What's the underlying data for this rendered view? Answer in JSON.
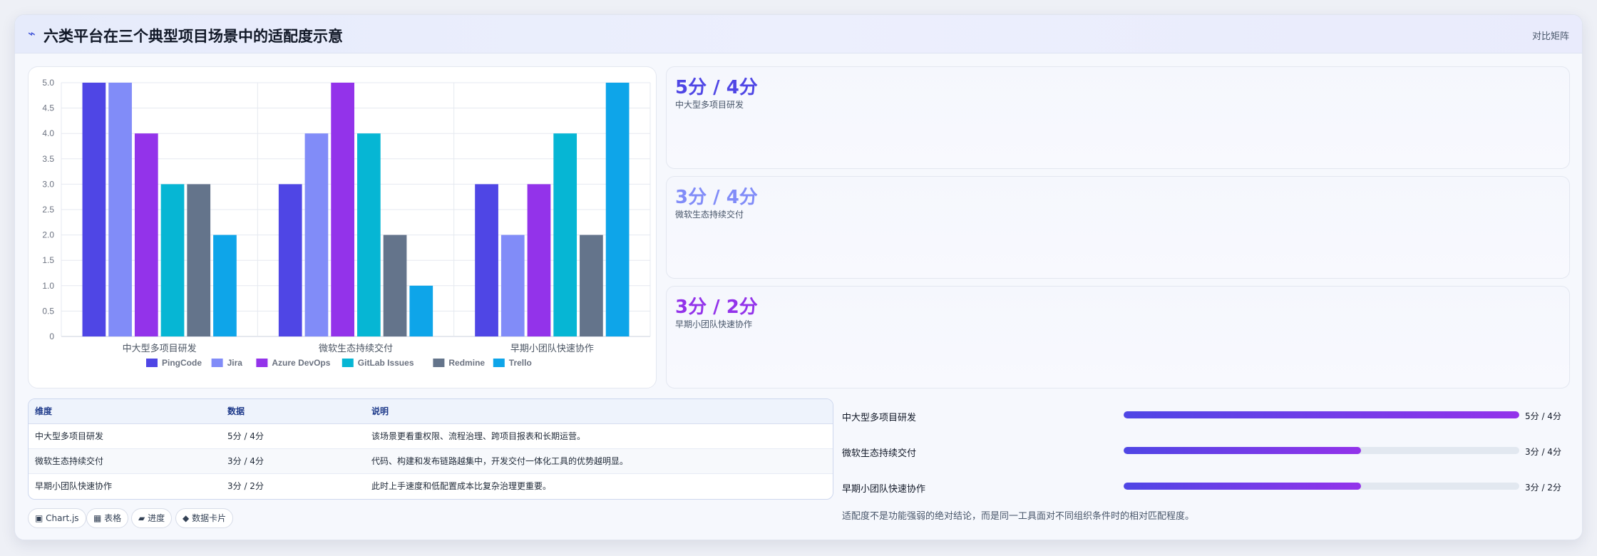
{
  "header": {
    "title": "六类平台在三个典型项目场景中的适配度示意",
    "title_icon": "activity-icon",
    "tag": "对比矩阵"
  },
  "chart_data": {
    "type": "bar",
    "categories": [
      "中大型多项目研发",
      "微软生态持续交付",
      "早期小团队快速协作"
    ],
    "series": [
      {
        "name": "PingCode",
        "values": [
          5,
          3,
          3
        ],
        "color": "#4f46e5"
      },
      {
        "name": "Jira",
        "values": [
          5,
          4,
          2
        ],
        "color": "#818cf8"
      },
      {
        "name": "Azure DevOps",
        "values": [
          4,
          5,
          3
        ],
        "color": "#9333ea"
      },
      {
        "name": "GitLab Issues",
        "values": [
          3,
          4,
          4
        ],
        "color": "#06b6d4"
      },
      {
        "name": "Redmine",
        "values": [
          3,
          2,
          2
        ],
        "color": "#64748b"
      },
      {
        "name": "Trello",
        "values": [
          2,
          1,
          5
        ],
        "color": "#0ea5e9"
      }
    ],
    "ylim": [
      0,
      5
    ],
    "yticks": [
      "0",
      "0.5",
      "1.0",
      "1.5",
      "2.0",
      "2.5",
      "3.0",
      "3.5",
      "4.0",
      "4.5",
      "5.0"
    ],
    "grid": true,
    "legend_position": "bottom"
  },
  "score_cards": [
    {
      "value": "5分 / 4分",
      "label": "中大型多项目研发",
      "color": "#4f46e5"
    },
    {
      "value": "3分 / 4分",
      "label": "微软生态持续交付",
      "color": "#818cf8"
    },
    {
      "value": "3分 / 2分",
      "label": "早期小团队快速协作",
      "color": "#9333ea"
    }
  ],
  "table": {
    "headers": [
      "维度",
      "数据",
      "说明"
    ],
    "rows": [
      [
        "中大型多项目研发",
        "5分 / 4分",
        "该场景更看重权限、流程治理、跨项目报表和长期运营。"
      ],
      [
        "微软生态持续交付",
        "3分 / 4分",
        "代码、构建和发布链路越集中，开发交付一体化工具的优势越明显。"
      ],
      [
        "早期小团队快速协作",
        "3分 / 2分",
        "此时上手速度和低配置成本比复杂治理更重要。"
      ]
    ]
  },
  "chips": [
    {
      "icon": "▣",
      "label": "Chart.js"
    },
    {
      "icon": "▦",
      "label": "表格"
    },
    {
      "icon": "▰",
      "label": "进度"
    },
    {
      "icon": "◆",
      "label": "数据卡片"
    }
  ],
  "progress": [
    {
      "label": "中大型多项目研发",
      "value": "5分 / 4分",
      "fraction": 1.0
    },
    {
      "label": "微软生态持续交付",
      "value": "3分 / 4分",
      "fraction": 0.6
    },
    {
      "label": "早期小团队快速协作",
      "value": "3分 / 2分",
      "fraction": 0.6
    }
  ],
  "footnote": "适配度不是功能强弱的绝对结论，而是同一工具面对不同组织条件时的相对匹配程度。"
}
